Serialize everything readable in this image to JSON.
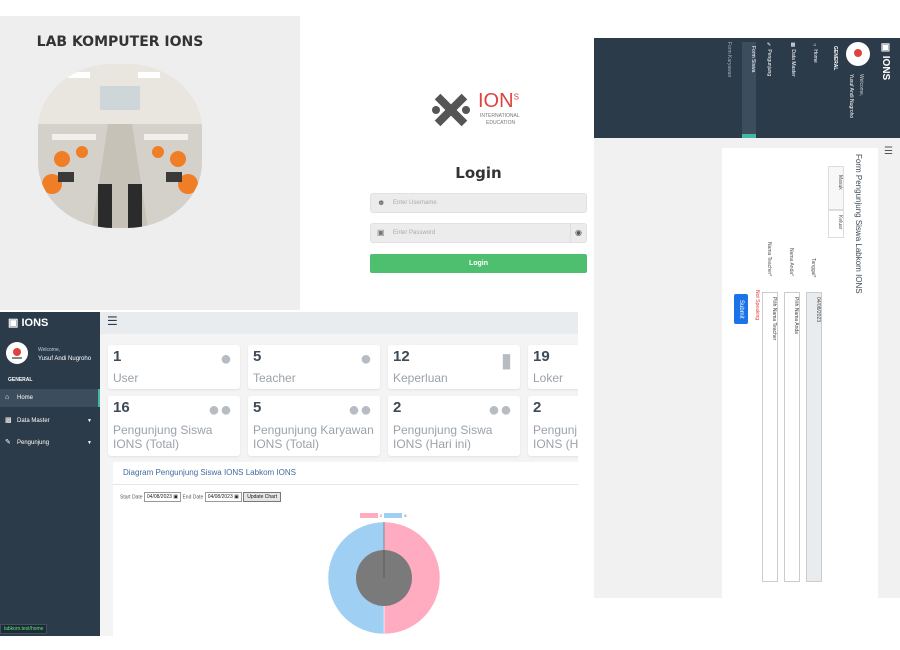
{
  "lab": {
    "title": "LAB KOMPUTER IONS"
  },
  "login": {
    "brand": "ION",
    "brand_sup": "S",
    "brand_sub1": "INTERNATIONAL",
    "brand_sub2": "EDUCATION",
    "title": "Login",
    "username_placeholder": "Enter Username",
    "password_placeholder": "Enter Password",
    "button": "Login",
    "accent": "#4dbf6f"
  },
  "dashboard": {
    "brand": "IONS",
    "welcome": "Welcome,",
    "user": "Yusuf Andi Nugroho",
    "section": "GENERAL",
    "nav": [
      {
        "label": "Home",
        "icon": "home-icon"
      },
      {
        "label": "Data Master",
        "icon": "monitor-icon"
      },
      {
        "label": "Pengunjung",
        "icon": "edit-icon"
      }
    ],
    "status_url": "labkom.test/home",
    "cards_row1": [
      {
        "num": "1",
        "label": "User",
        "icon": "user-icon"
      },
      {
        "num": "5",
        "label": "Teacher",
        "icon": "user-icon"
      },
      {
        "num": "12",
        "label": "Keperluan",
        "icon": "briefcase-icon"
      },
      {
        "num": "19",
        "label": "Loker",
        "icon": "box-icon"
      }
    ],
    "cards_row2": [
      {
        "num": "16",
        "label1": "Pengunjung Siswa",
        "label2": "IONS (Total)",
        "icon": "users-icon"
      },
      {
        "num": "5",
        "label1": "Pengunjung Karyawan",
        "label2": "IONS (Total)",
        "icon": "users-icon"
      },
      {
        "num": "2",
        "label1": "Pengunjung Siswa",
        "label2": "IONS (Hari ini)",
        "icon": "users-icon"
      },
      {
        "num": "2",
        "label1": "Pengunj",
        "label2": "IONS (H",
        "icon": "users-icon"
      }
    ],
    "chart": {
      "title": "Diagram Pengunjung Siswa IONS Labkom IONS",
      "start_label": "Start Date",
      "start_value": "04/08/2023",
      "end_label": "End Date",
      "end_value": "04/08/2023",
      "update_button": "Update Chart",
      "colors": [
        "#ffabc0",
        "#9fcff2"
      ]
    }
  },
  "chart_data": {
    "type": "pie",
    "categories": [
      "2",
      "8"
    ],
    "values": [
      1,
      1
    ],
    "legend_position": "top"
  },
  "form": {
    "brand": "IONS",
    "welcome": "Welcome,",
    "user": "Yusuf Andi Nugroho",
    "section": "GENERAL",
    "nav_home": "Home",
    "nav_data": "Data Master",
    "nav_pengunjung": "Pengunjung",
    "nav_siswa": "Form Siswa",
    "nav_karyawan": "Form Karyawan",
    "title": "Form Pengunjung Siswa Labkom IONS",
    "tab_masuk": "Masuk",
    "tab_keluar": "Keluar",
    "tanggal_label": "Tanggal*",
    "tanggal_value": "04/08/2023",
    "nama_label": "Nama Anda*",
    "nama_value": "Pilih Nama Anda",
    "teacher_label": "Nama Teacher*",
    "teacher_value": "Pilih Nama Teacher",
    "warning": "Not Speaking",
    "submit": "Submit"
  }
}
